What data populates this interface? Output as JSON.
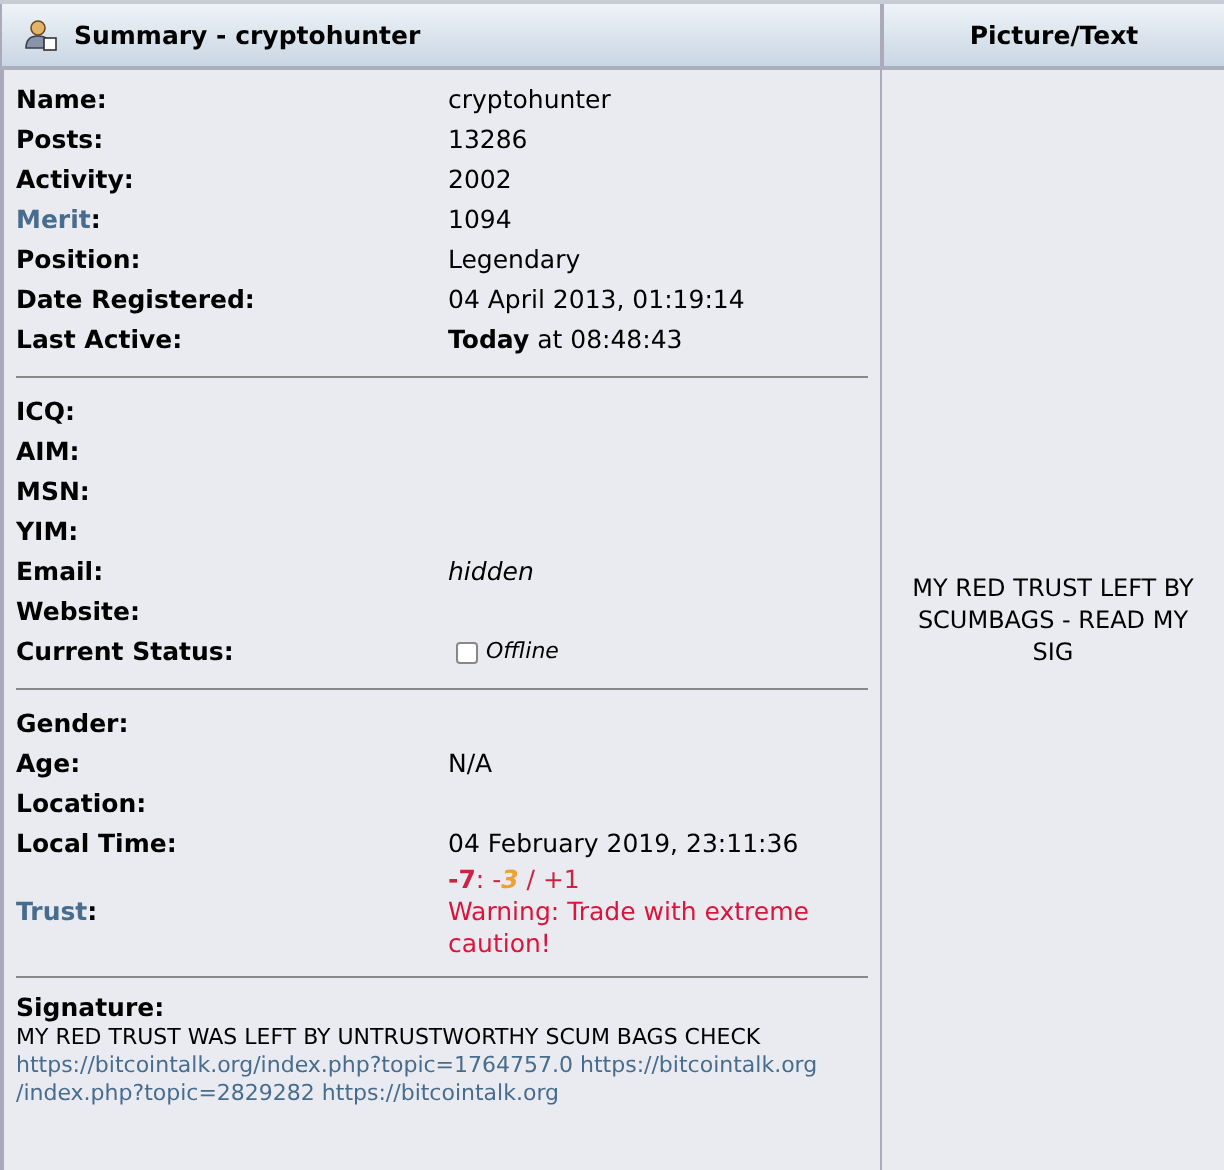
{
  "header": {
    "title": "Summary - cryptohunter",
    "side_title": "Picture/Text"
  },
  "sections": [
    {
      "rows": [
        {
          "label": "Name:",
          "link": false,
          "value": "cryptohunter",
          "kind": "plain"
        },
        {
          "label": "Posts:",
          "link": false,
          "value": "13286",
          "kind": "plain"
        },
        {
          "label": "Activity:",
          "link": false,
          "value": "2002",
          "kind": "plain"
        },
        {
          "label": "Merit",
          "suffix": ":",
          "link": true,
          "value": "1094",
          "kind": "plain"
        },
        {
          "label": "Position:",
          "link": false,
          "value": "Legendary",
          "kind": "plain"
        },
        {
          "label": "Date Registered:",
          "link": false,
          "value": "04 April 2013, 01:19:14",
          "kind": "plain"
        },
        {
          "label": "Last Active:",
          "link": false,
          "value": "**Today** at 08:48:43",
          "kind": "rich"
        }
      ]
    },
    {
      "rows": [
        {
          "label": "ICQ:",
          "link": false,
          "kind": "empty"
        },
        {
          "label": "AIM:",
          "link": false,
          "kind": "empty"
        },
        {
          "label": "MSN:",
          "link": false,
          "kind": "empty"
        },
        {
          "label": "YIM:",
          "link": false,
          "kind": "empty"
        },
        {
          "label": "Email:",
          "link": false,
          "value": "hidden",
          "kind": "italic"
        },
        {
          "label": "Website:",
          "link": false,
          "kind": "empty"
        },
        {
          "label": "Current Status:",
          "link": false,
          "value": "Offline",
          "kind": "status",
          "online": false
        }
      ]
    },
    {
      "rows": [
        {
          "label": "Gender:",
          "link": false,
          "kind": "empty"
        },
        {
          "label": "Age:",
          "link": false,
          "value": "N/A",
          "kind": "plain"
        },
        {
          "label": "Location:",
          "link": false,
          "kind": "empty"
        },
        {
          "label": "Local Time:",
          "link": false,
          "value": "04 February 2019, 23:11:36",
          "kind": "plain"
        },
        {
          "label": "Trust",
          "suffix": ":",
          "link": true,
          "kind": "trust",
          "score": [
            {
              "text": "-7",
              "kind": "negative"
            },
            {
              "text": ": -",
              "kind": "sep"
            },
            {
              "text": "3",
              "kind": "neutral"
            },
            {
              "text": " / +1",
              "kind": "sep"
            }
          ],
          "warning": "Warning: Trade with extreme caution!"
        }
      ]
    }
  ],
  "signature": {
    "label": "Signature:",
    "lines": [
      {
        "text": "MY RED TRUST WAS LEFT BY UNTRUSTWORTHY SCUM BAGS CHECK",
        "kind": "text"
      },
      {
        "text": "https://bitcointalk.org/index.php?topic=1764757.0 https://bitcointalk.org",
        "kind": "link"
      },
      {
        "text": "/index.php?topic=2829282 https://bitcointalk.org",
        "kind": "link"
      }
    ]
  },
  "side_text": "MY RED TRUST LEFT BY SCUMBAGS - READ MY SIG"
}
